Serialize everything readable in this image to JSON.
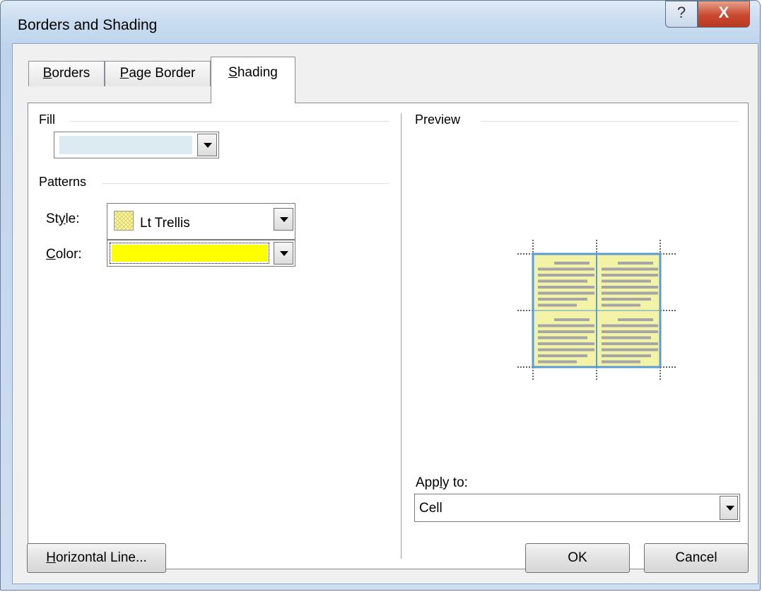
{
  "window": {
    "title": "Borders and Shading",
    "help_glyph": "?",
    "close_glyph": "X"
  },
  "tabs": [
    {
      "label_first": "B",
      "label_rest": "orders",
      "active": false
    },
    {
      "label_first": "P",
      "label_rest": "age Border",
      "active": false
    },
    {
      "label_first": "S",
      "label_rest": "hading",
      "active": true
    }
  ],
  "fill": {
    "group_label": "Fill",
    "color": "#dbebf1"
  },
  "patterns": {
    "group_label": "Patterns",
    "style_label_pre": "St",
    "style_label_acc": "y",
    "style_label_post": "le:",
    "style_value": "Lt Trellis",
    "swatch_color": "#fcf8a8",
    "color_label_acc": "C",
    "color_label_post": "olor:",
    "color_value": "#ffff00"
  },
  "preview": {
    "group_label": "Preview",
    "cell_fill": "#f2f3a6",
    "border_color": "#5b9bd5",
    "text_line_color": "#a6a6a6"
  },
  "apply_to": {
    "label_pre": "App",
    "label_acc": "l",
    "label_post": "y to:",
    "value": "Cell"
  },
  "buttons": {
    "horizontal_line_acc": "H",
    "horizontal_line_rest": "orizontal Line...",
    "ok": "OK",
    "cancel": "Cancel"
  }
}
